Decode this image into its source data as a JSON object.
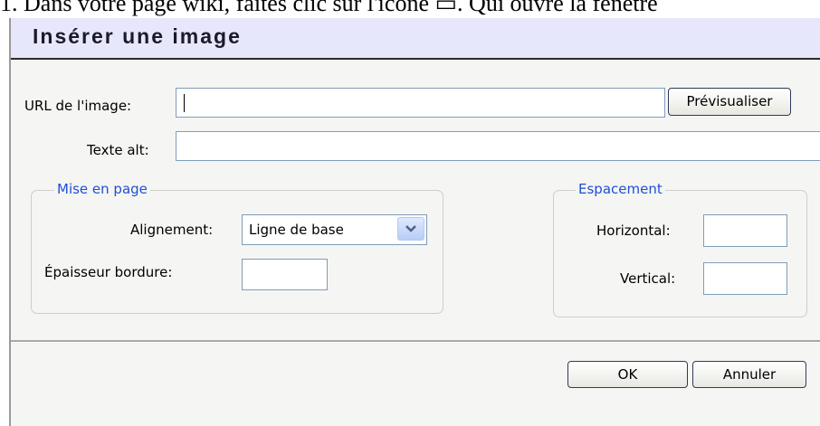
{
  "background_text": "1.  Dans votre page wiki, faites clic sur l'icône ▭. Qui ouvre la fenêtre",
  "dialog": {
    "title": "Insérer une image",
    "url_label": "URL de l'image:",
    "url_value": "",
    "preview_button": "Prévisualiser",
    "alt_label": "Texte alt:",
    "alt_value": "",
    "layout": {
      "legend": "Mise en page",
      "alignment_label": "Alignement:",
      "alignment_value": "Ligne de base",
      "border_label": "Épaisseur bordure:",
      "border_value": ""
    },
    "spacing": {
      "legend": "Espacement",
      "horizontal_label": "Horizontal:",
      "horizontal_value": "",
      "vertical_label": "Vertical:",
      "vertical_value": ""
    },
    "ok_button": "OK",
    "cancel_button": "Annuler"
  },
  "colors": {
    "title_bar": "#e7e7fb",
    "legend_text": "#1f4fd6",
    "dialog_bg": "#f5f5f3"
  },
  "icons": {
    "dropdown": "chevron-down-icon"
  }
}
